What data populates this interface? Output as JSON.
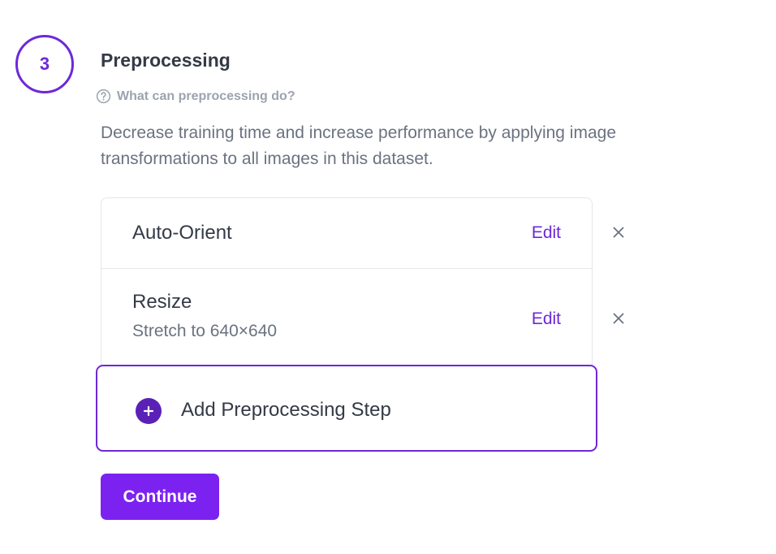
{
  "step": {
    "number": "3",
    "title": "Preprocessing",
    "help_link": "What can preprocessing do?",
    "description": "Decrease training time and increase performance by applying image transformations to all images in this dataset."
  },
  "preprocessing_steps": [
    {
      "name": "Auto-Orient",
      "detail": "",
      "edit_label": "Edit",
      "remove_icon": "close-icon"
    },
    {
      "name": "Resize",
      "detail": "Stretch to 640×640",
      "edit_label": "Edit",
      "remove_icon": "close-icon"
    }
  ],
  "add_step": {
    "label": "Add Preprocessing Step",
    "icon": "plus-circle-icon"
  },
  "continue_label": "Continue",
  "colors": {
    "accent": "#6d28d9",
    "button": "#7c22f0",
    "text_primary": "#343a46",
    "text_secondary": "#6b7280",
    "text_muted": "#9ca3af",
    "border": "#e5e7eb"
  }
}
